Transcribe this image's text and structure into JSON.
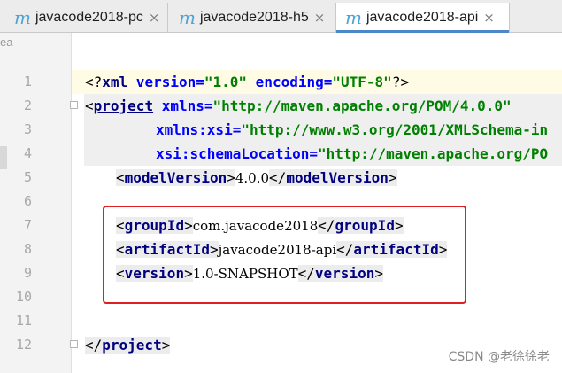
{
  "tabs": [
    {
      "icon": "m",
      "label": "javacode2018-pc",
      "close": "×"
    },
    {
      "icon": "m",
      "label": "javacode2018-h5",
      "close": "×"
    },
    {
      "icon": "m",
      "label": "javacode2018-api",
      "close": "×"
    }
  ],
  "edge_char": "ea",
  "line_numbers": [
    "1",
    "2",
    "3",
    "4",
    "5",
    "6",
    "7",
    "8",
    "9",
    "10",
    "11",
    "12"
  ],
  "code": {
    "l1": {
      "open": "<?",
      "tag": "xml",
      "a1": " version=",
      "v1": "\"1.0\"",
      "a2": " encoding=",
      "v2": "\"UTF-8\"",
      "close": "?>"
    },
    "l2": {
      "open": "<",
      "tag": "project",
      "a1": " xmlns=",
      "v1": "\"http://maven.apache.org/POM/4.0.0\""
    },
    "l3": {
      "a1": "xmlns:xsi=",
      "v1": "\"http://www.w3.org/2001/XMLSchema-in"
    },
    "l4": {
      "a1": "xsi:schemaLocation=",
      "v1": "\"http://maven.apache.org/PO"
    },
    "l5": {
      "tag": "modelVersion",
      "text": "4.0.0"
    },
    "l7": {
      "tag": "groupId",
      "text": "com.javacode2018"
    },
    "l8": {
      "tag": "artifactId",
      "text": "javacode2018-api"
    },
    "l9": {
      "tag": "version",
      "text": "1.0-SNAPSHOT"
    },
    "l12": {
      "tag": "project"
    }
  },
  "watermark": "CSDN @老徐徐老",
  "colors": {
    "highlight_box": "#e02020",
    "active_tab_underline": "#4a88c7",
    "tag": "#000080",
    "attr": "#0000ff",
    "string": "#008000"
  }
}
